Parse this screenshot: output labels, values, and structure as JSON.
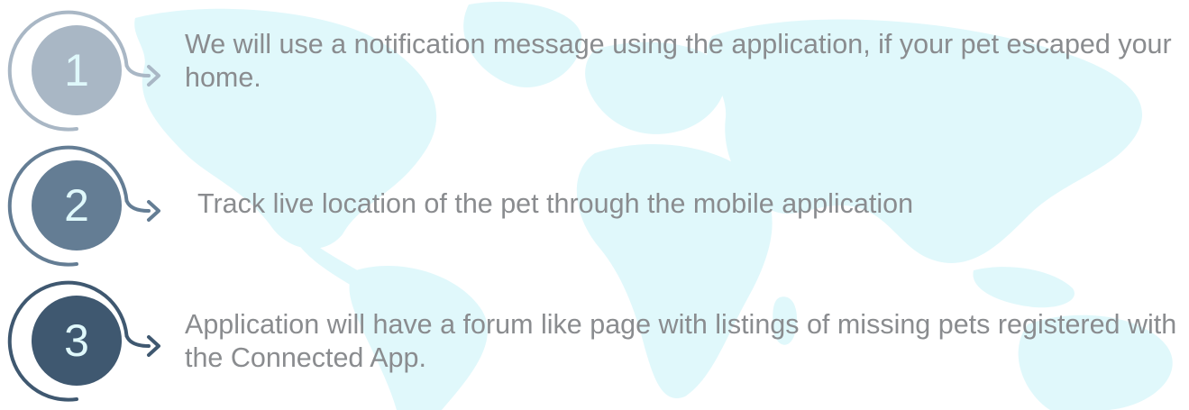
{
  "steps": [
    {
      "number": "1",
      "text": "We will use a notification message using the application, if your pet escaped your home."
    },
    {
      "number": "2",
      "text": "Track live location of the pet through the mobile application"
    },
    {
      "number": "3",
      "text": "Application will have a forum like page with listings of missing pets registered with the Connected App."
    }
  ],
  "colors": {
    "background_map": "#e0f8fb",
    "step1": "#a9b7c5",
    "step2": "#647d94",
    "step3": "#3f5870",
    "number_text": "#dff8fb",
    "body_text": "#8a8c8f"
  },
  "icons": [
    "world-map",
    "arrow-right-icon"
  ]
}
